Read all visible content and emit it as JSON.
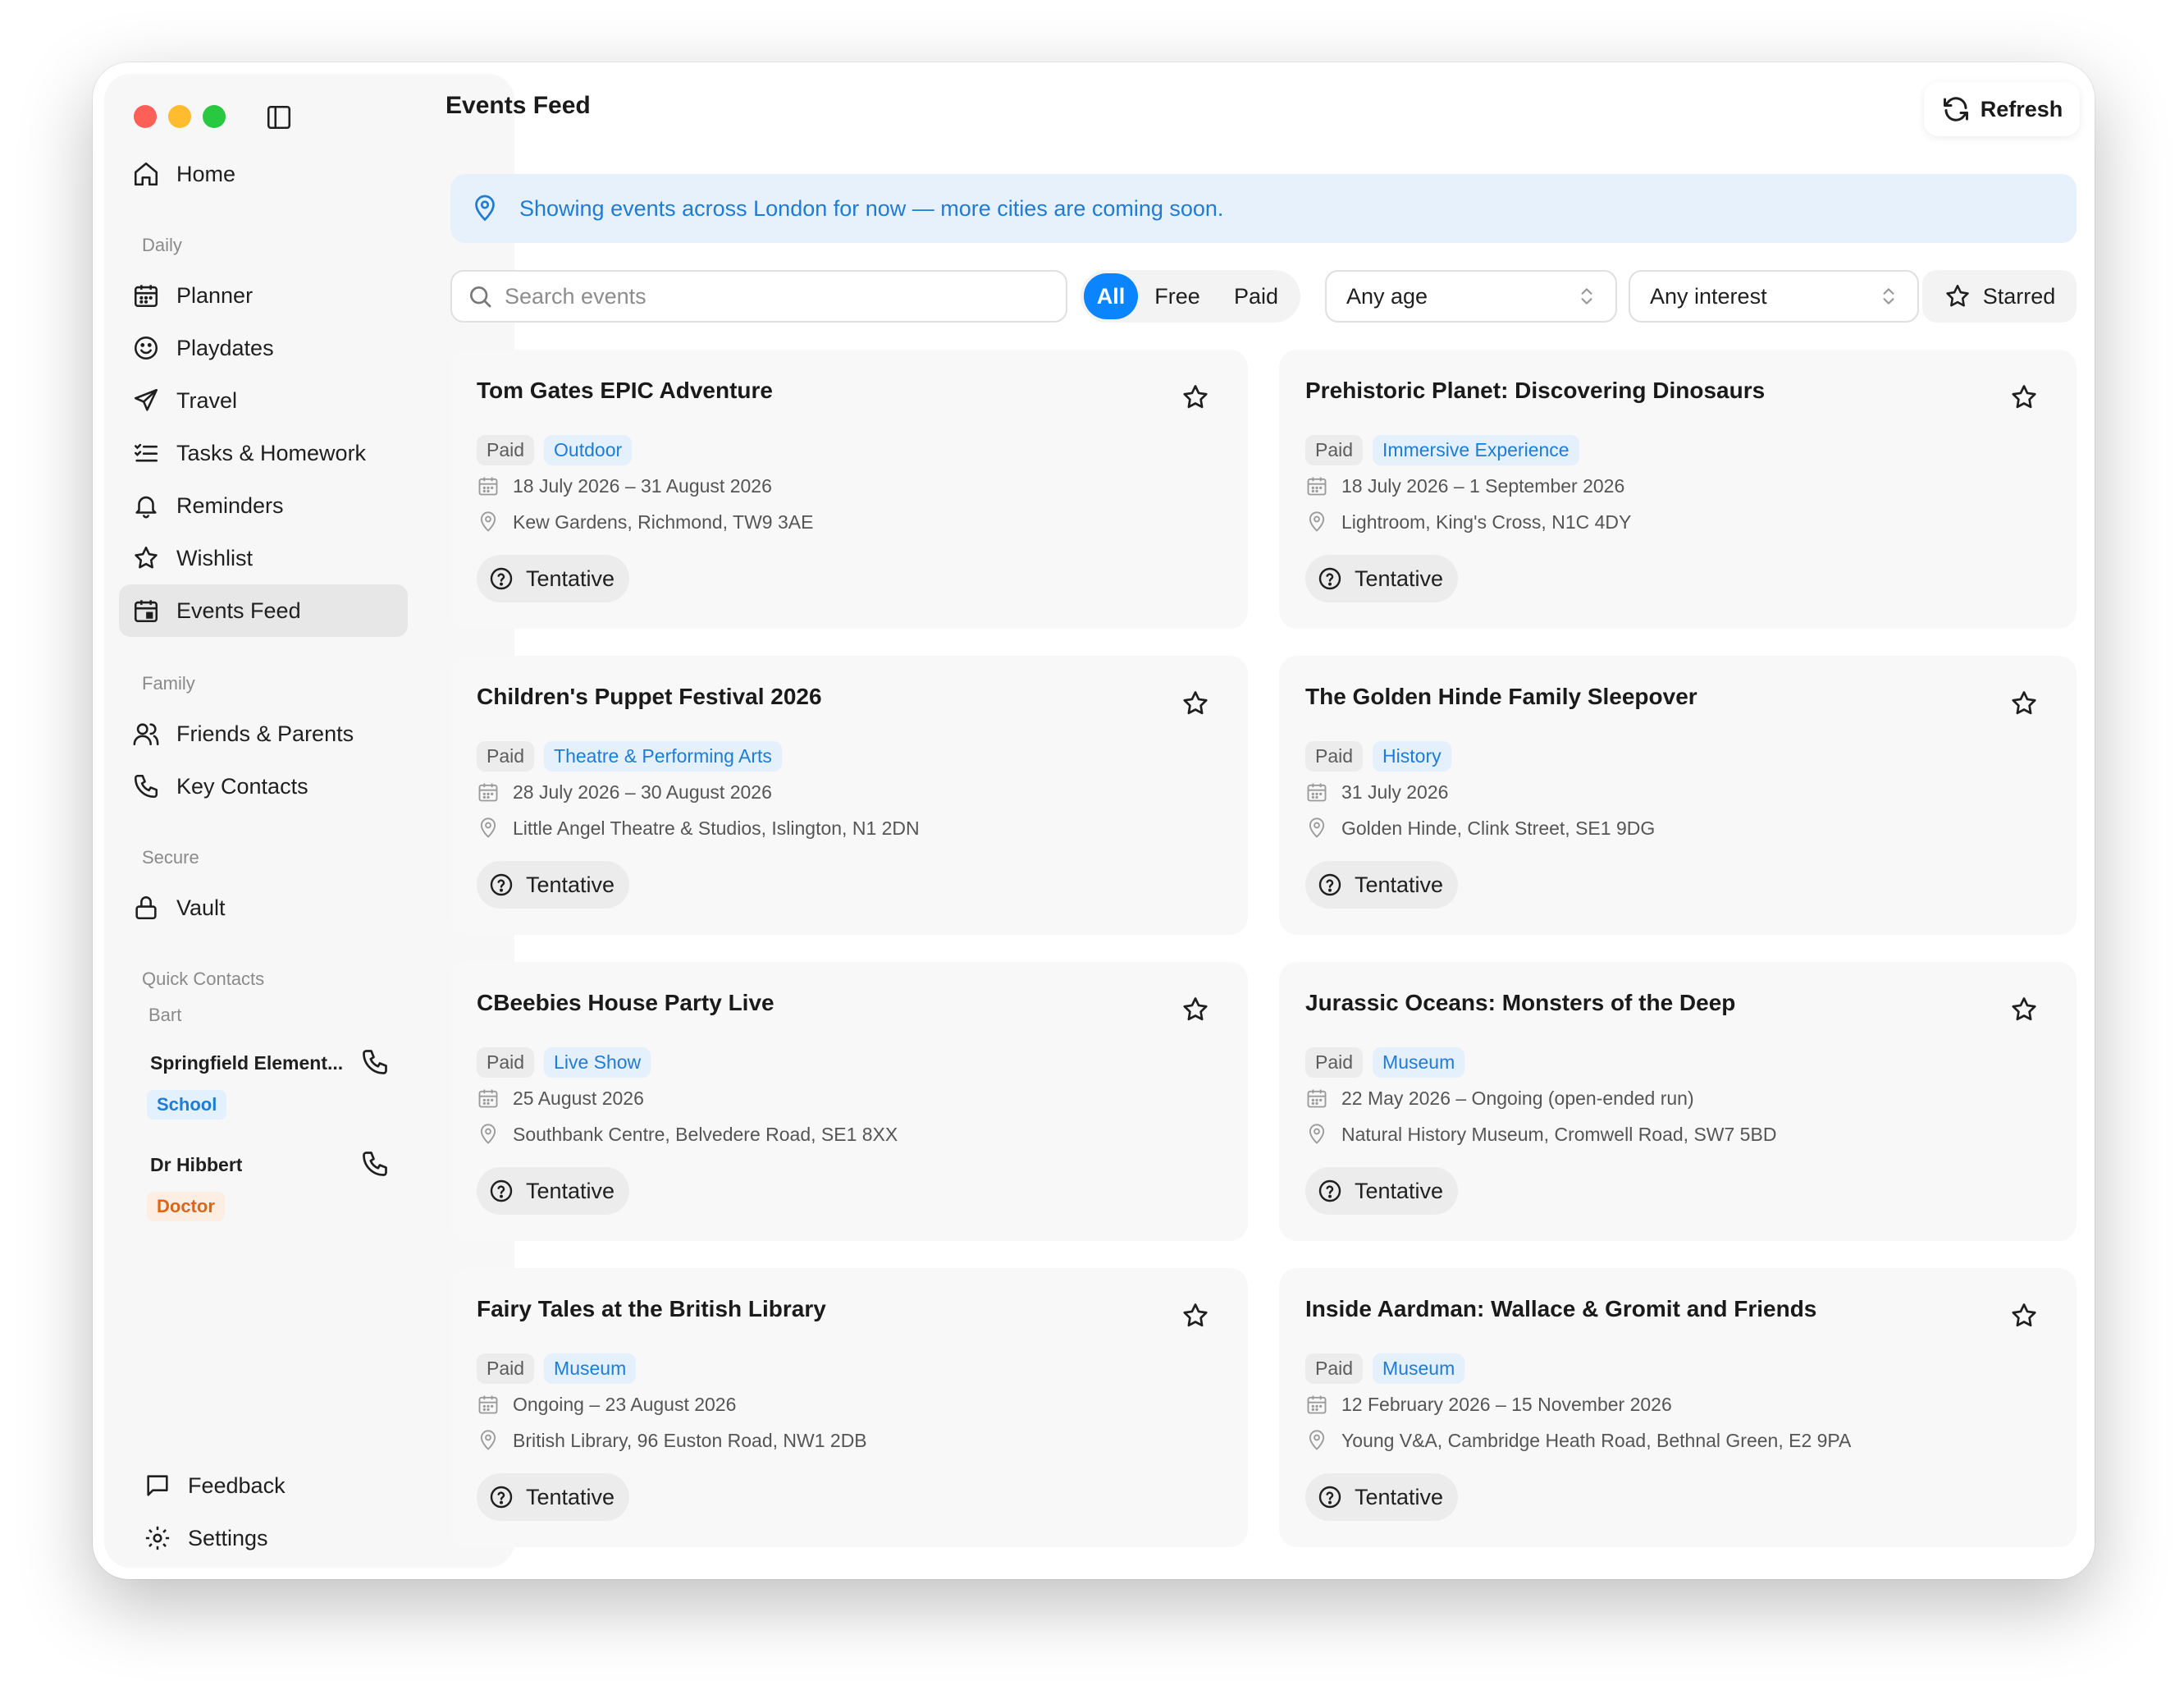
{
  "sidebar": {
    "home": "Home",
    "sections": {
      "daily": "Daily",
      "family": "Family",
      "secure": "Secure",
      "quick_contacts": "Quick Contacts"
    },
    "daily_items": [
      "Planner",
      "Playdates",
      "Travel",
      "Tasks & Homework",
      "Reminders",
      "Wishlist",
      "Events Feed"
    ],
    "family_items": [
      "Friends & Parents",
      "Key Contacts"
    ],
    "secure_items": [
      "Vault"
    ],
    "quick_contacts": {
      "group": "Bart",
      "contacts": [
        {
          "name": "Springfield Element...",
          "tag": "School"
        },
        {
          "name": "Dr Hibbert",
          "tag": "Doctor"
        }
      ]
    },
    "footer": {
      "feedback": "Feedback",
      "settings": "Settings"
    }
  },
  "header": {
    "title": "Events Feed",
    "refresh": "Refresh"
  },
  "banner": {
    "text": "Showing events across London for now — more cities are coming soon."
  },
  "filters": {
    "search_placeholder": "Search events",
    "price": [
      "All",
      "Free",
      "Paid"
    ],
    "price_selected": "All",
    "age": "Any age",
    "interest": "Any interest",
    "starred": "Starred"
  },
  "events": [
    {
      "title": "Tom Gates EPIC Adventure",
      "price": "Paid",
      "category": "Outdoor",
      "date": "18 July 2026 – 31 August 2026",
      "location": "Kew Gardens, Richmond, TW9 3AE",
      "status": "Tentative"
    },
    {
      "title": "Prehistoric Planet: Discovering Dinosaurs",
      "price": "Paid",
      "category": "Immersive Experience",
      "date": "18 July 2026 – 1 September 2026",
      "location": "Lightroom, King's Cross, N1C 4DY",
      "status": "Tentative"
    },
    {
      "title": "Children's Puppet Festival 2026",
      "price": "Paid",
      "category": "Theatre & Performing Arts",
      "date": "28 July 2026 – 30 August 2026",
      "location": "Little Angel Theatre & Studios, Islington, N1 2DN",
      "status": "Tentative"
    },
    {
      "title": "The Golden Hinde Family Sleepover",
      "price": "Paid",
      "category": "History",
      "date": "31 July 2026",
      "location": "Golden Hinde, Clink Street, SE1 9DG",
      "status": "Tentative"
    },
    {
      "title": "CBeebies House Party Live",
      "price": "Paid",
      "category": "Live Show",
      "date": "25 August 2026",
      "location": "Southbank Centre, Belvedere Road, SE1 8XX",
      "status": "Tentative"
    },
    {
      "title": "Jurassic Oceans: Monsters of the Deep",
      "price": "Paid",
      "category": "Museum",
      "date": "22 May 2026 – Ongoing (open-ended run)",
      "location": "Natural History Museum, Cromwell Road, SW7 5BD",
      "status": "Tentative"
    },
    {
      "title": "Fairy Tales at the British Library",
      "price": "Paid",
      "category": "Museum",
      "date": "Ongoing – 23 August 2026",
      "location": "British Library, 96 Euston Road, NW1 2DB",
      "status": "Tentative"
    },
    {
      "title": "Inside Aardman: Wallace & Gromit and Friends",
      "price": "Paid",
      "category": "Museum",
      "date": "12 February 2026 – 15 November 2026",
      "location": "Young V&A, Cambridge Heath Road, Bethnal Green, E2 9PA",
      "status": "Tentative"
    }
  ],
  "colors": {
    "accent": "#0a84ff",
    "link_blue": "#1e7cd6",
    "doctor_orange": "#d9661a"
  }
}
